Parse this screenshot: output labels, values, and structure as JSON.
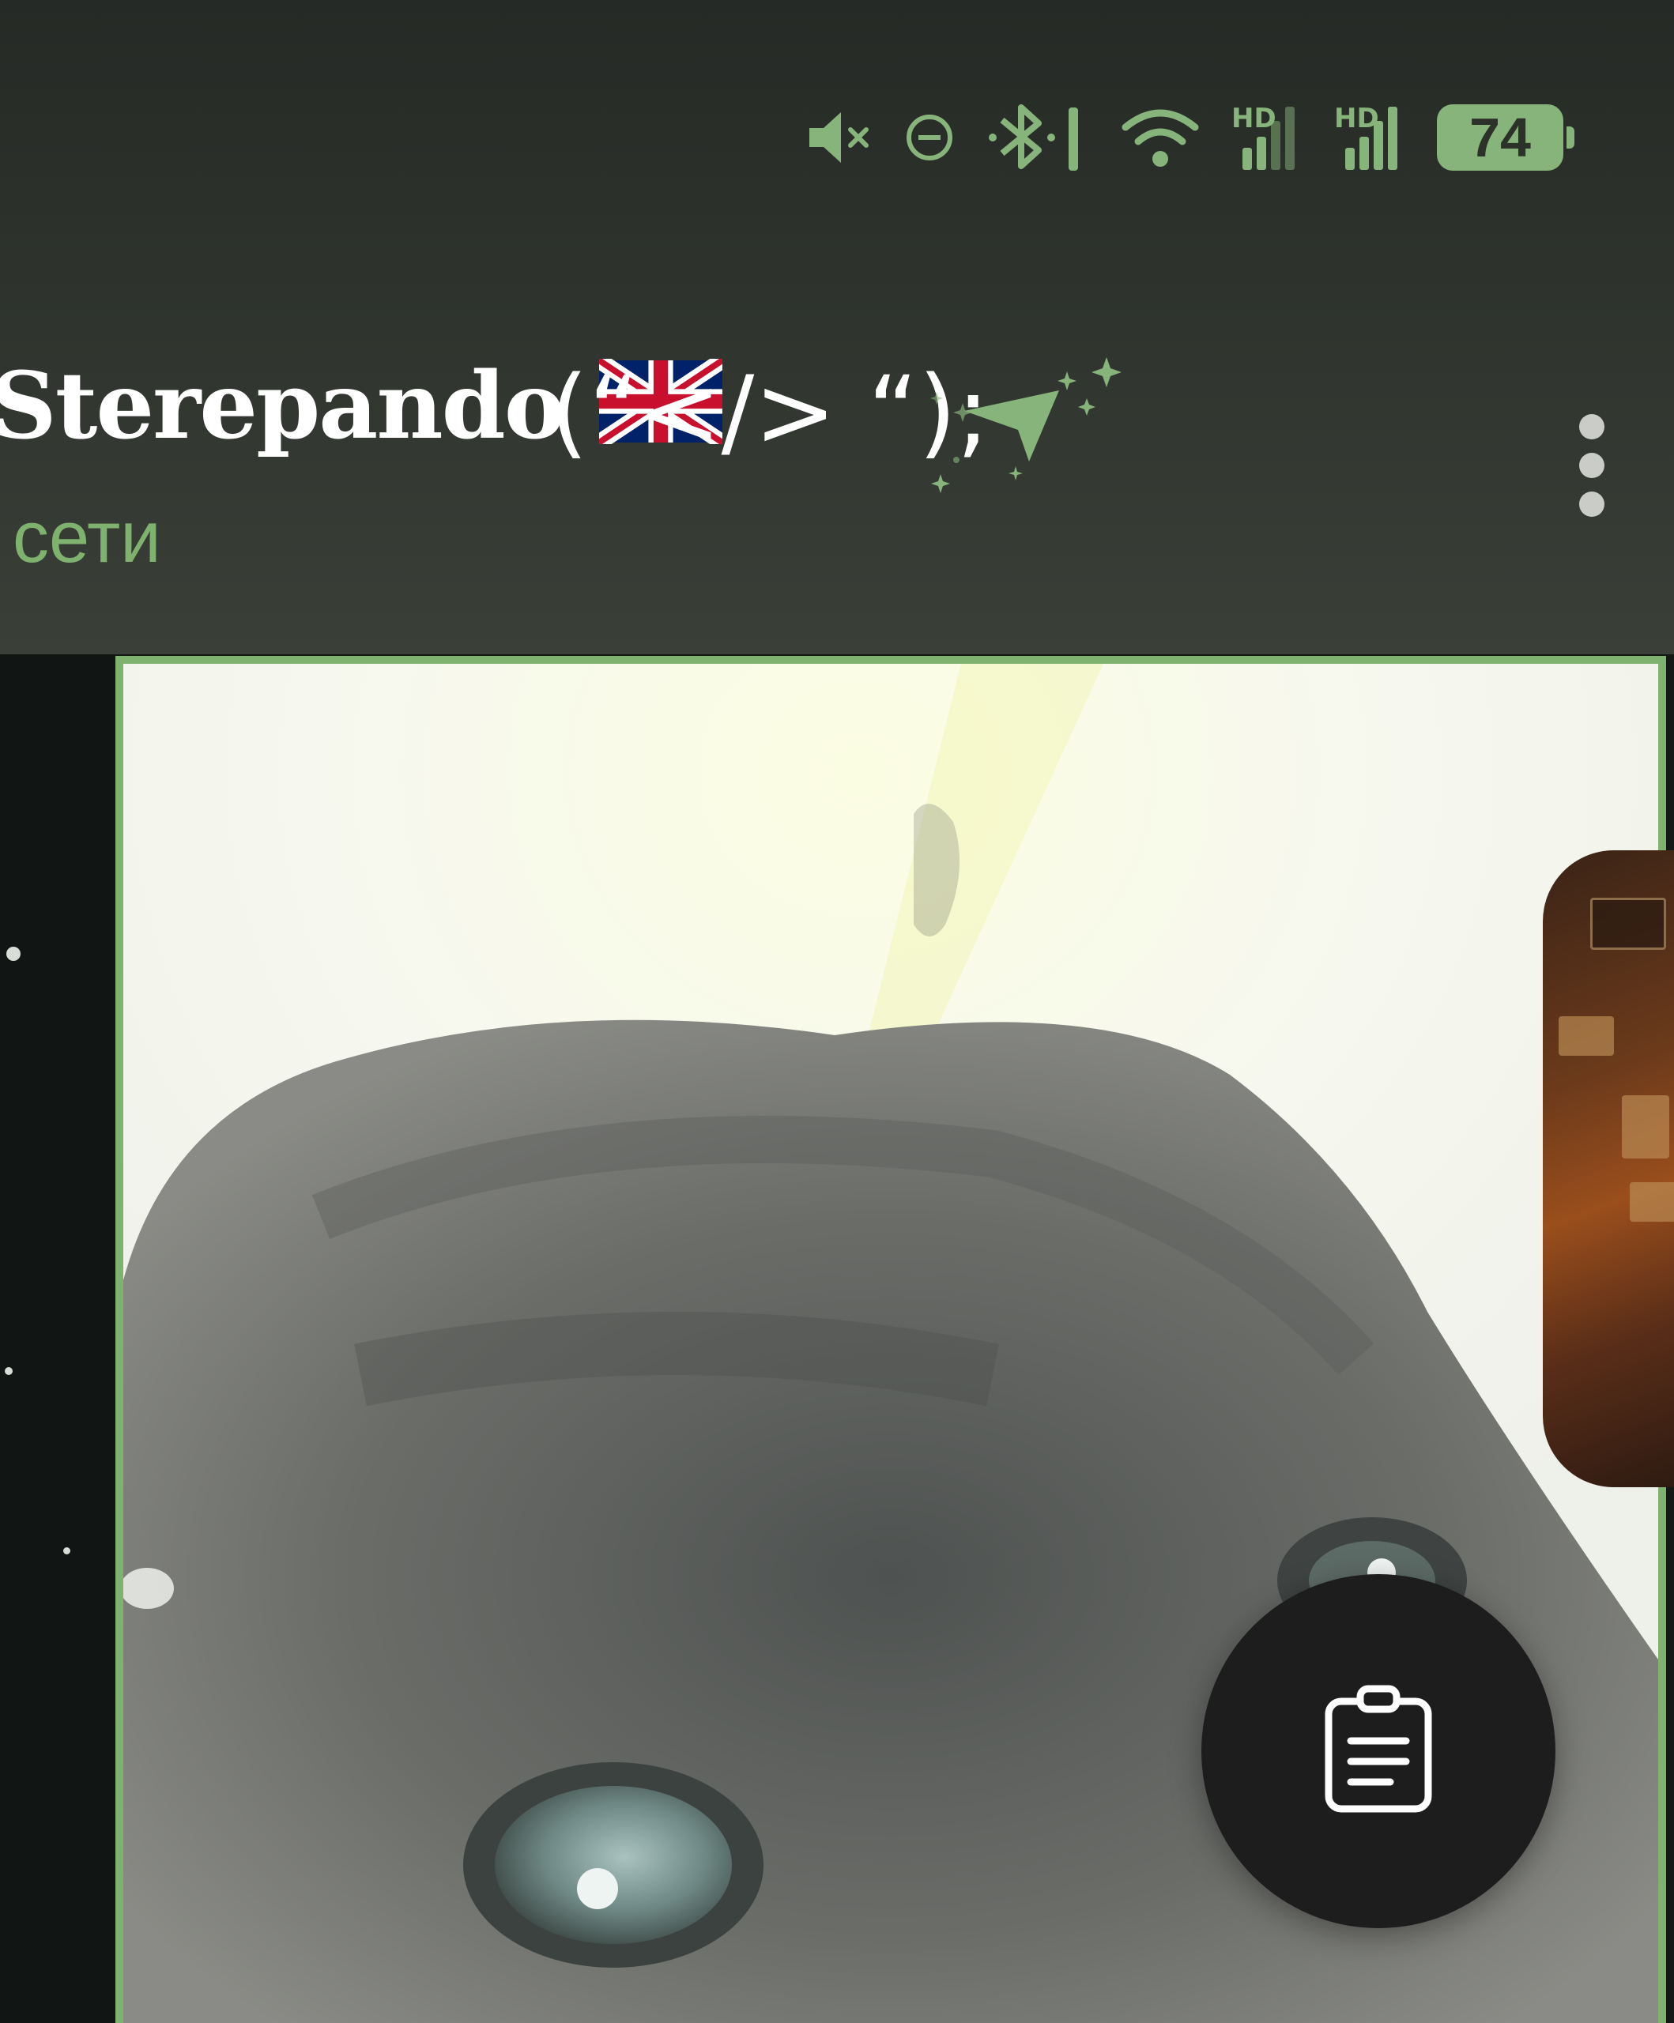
{
  "status_bar": {
    "icons": [
      "muted-volume-icon",
      "do-not-disturb-icon",
      "bluetooth-icon",
      "wifi-icon",
      "hd-signal-icon",
      "hd-signal-icon"
    ],
    "hd_label": "HD",
    "battery_percent": "74",
    "accent_color": "#86b47a"
  },
  "chat_header": {
    "title": "Sterepando",
    "flag": "🇬🇧",
    "code": "(“</> “);",
    "status": "сети",
    "status_color": "#7fb26f",
    "menu_icon": "more-vertical-icon"
  },
  "video_call": {
    "frame_color": "#7fb26f",
    "action_button_icon": "clipboard-icon"
  }
}
